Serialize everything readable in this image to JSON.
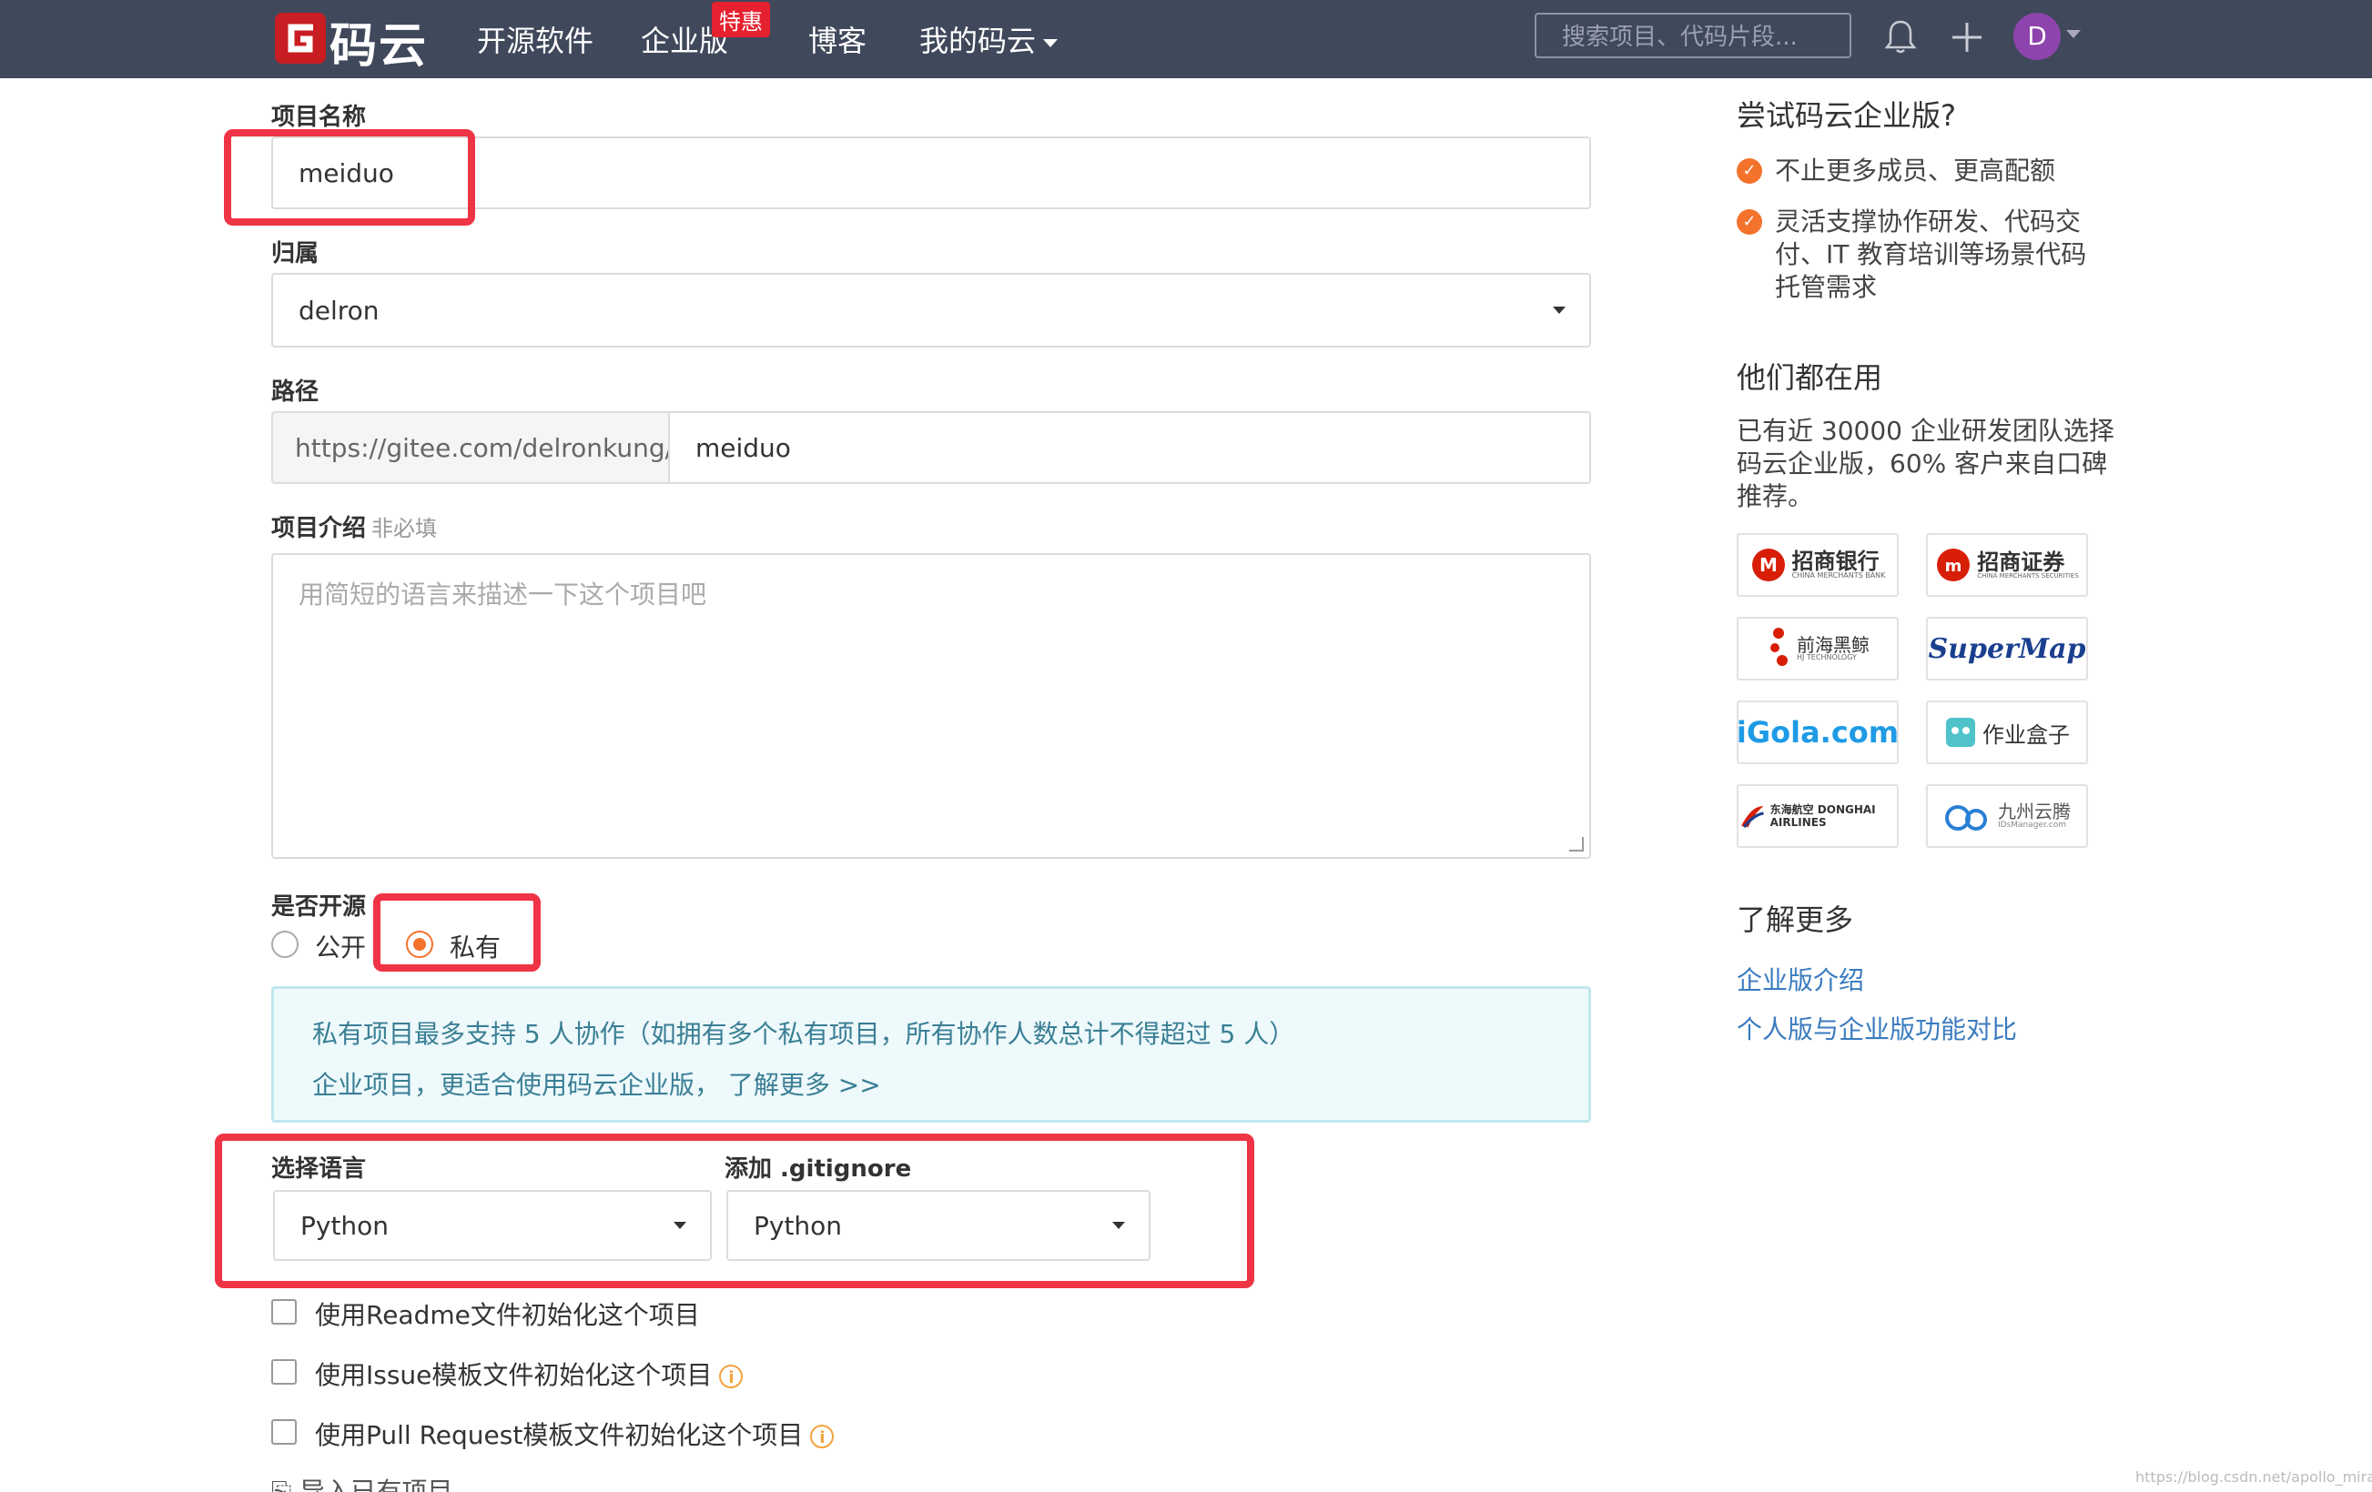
{
  "nav": {
    "logo_text": "码云",
    "items": [
      "开源软件",
      "企业版",
      "博客",
      "我的码云"
    ],
    "badge": "特惠",
    "search_placeholder": "搜索项目、代码片段...",
    "avatar_letter": "D",
    "icons": [
      "bell-icon",
      "plus-icon"
    ]
  },
  "form": {
    "project_name_label": "项目名称",
    "project_name_value": "meiduo",
    "owner_label": "归属",
    "owner_value": "delron",
    "path_label": "路径",
    "path_prefix": "https://gitee.com/delronkung/",
    "path_value": "meiduo",
    "desc_label": "项目介绍",
    "desc_optional": "非必填",
    "desc_placeholder": "用简短的语言来描述一下这个项目吧",
    "open_label": "是否开源",
    "radio_public": "公开",
    "radio_private": "私有",
    "info_line1": "私有项目最多支持 5 人协作（如拥有多个私有项目，所有协作人数总计不得超过 5 人）",
    "info_line2": "企业项目，更适合使用码云企业版， 了解更多 >>",
    "lang_label": "选择语言",
    "lang_value": "Python",
    "gitignore_label": "添加 .gitignore",
    "gitignore_value": "Python",
    "check_readme": "使用Readme文件初始化这个项目",
    "check_issue": "使用Issue模板文件初始化这个项目",
    "check_pr": "使用Pull Request模板文件初始化这个项目",
    "import_label": "导入已有项目"
  },
  "sidebar": {
    "try_title": "尝试码云企业版?",
    "benefit_1": "不止更多成员、更高配额",
    "benefit_2": "灵活支撑协作研发、代码交付、IT 教育培训等场景代码托管需求",
    "users_title": "他们都在用",
    "users_text": "已有近 30000 企业研发团队选择码云企业版，60% 客户来自口碑推荐。",
    "logos": [
      "招商银行",
      "招商证券",
      "前海黑鲸",
      "SuperMap",
      "iGola.com",
      "作业盒子",
      "东海航空 DONGHAI AIRLINES",
      "九州云腾"
    ],
    "logo_subs": [
      "CHINA MERCHANTS BANK",
      "CHINA MERCHANTS SECURITIES",
      "HJ TECHNOLOGY",
      "",
      "",
      "",
      "",
      "IDsManager.com"
    ],
    "more_title": "了解更多",
    "link_1": "企业版介绍",
    "link_2": "个人版与企业版功能对比"
  },
  "watermark": "https://blog.csdn.net/apollo_miracle",
  "colors": {
    "accent": "#f3722c",
    "highlight": "#ef3446",
    "nav_bg": "#40485b",
    "brand_red": "#c71d23"
  }
}
